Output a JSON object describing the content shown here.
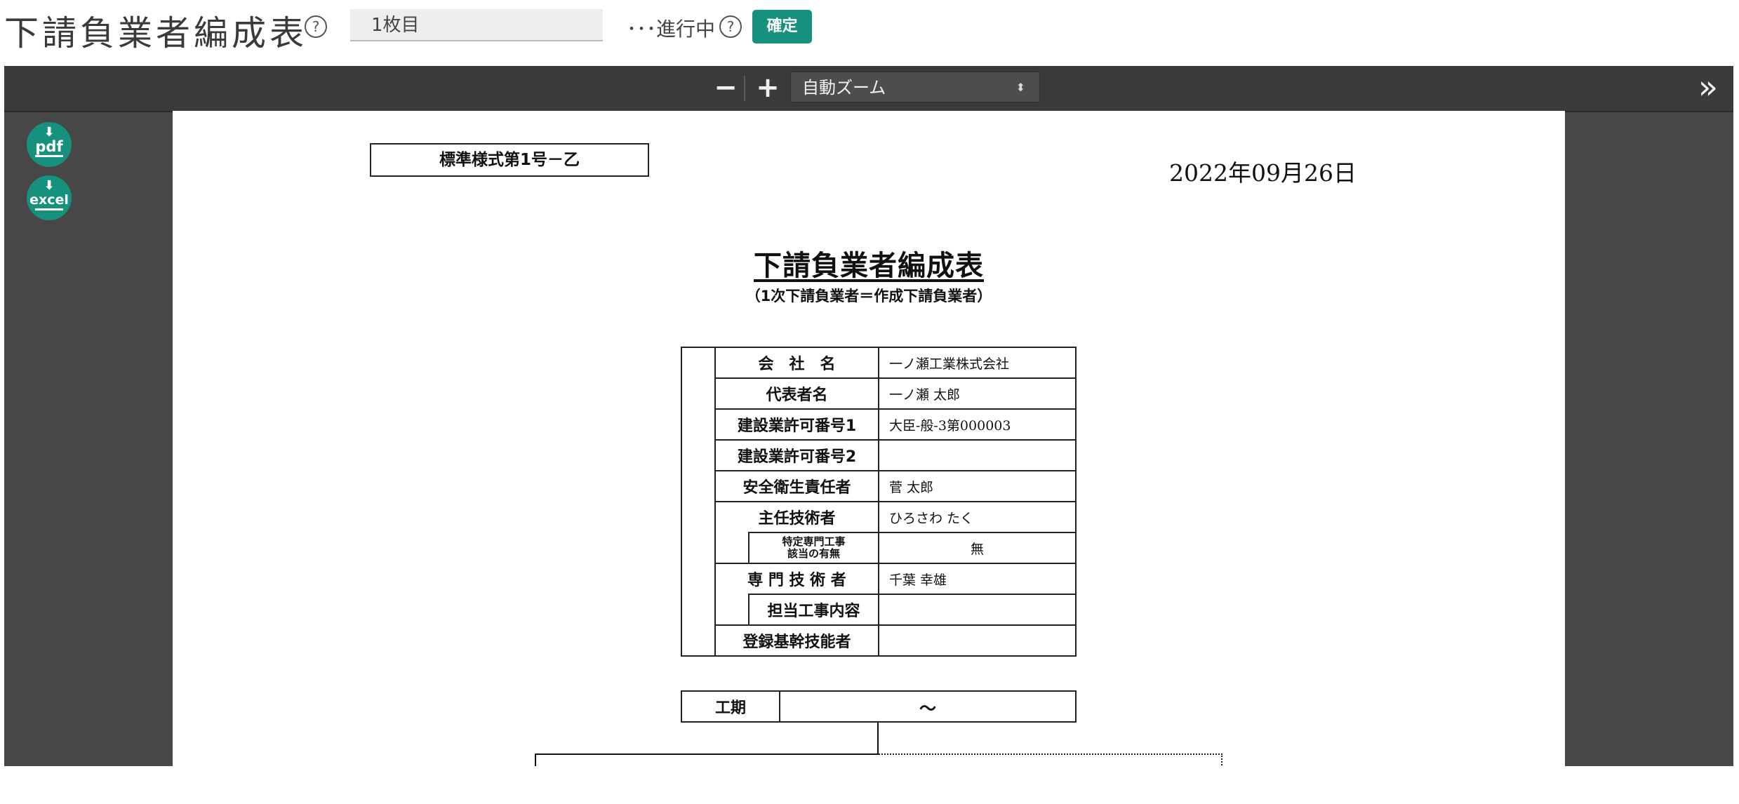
{
  "header": {
    "title": "下請負業者編成表",
    "sheet_value": "1枚目",
    "status": "･･･進行中",
    "confirm_label": "確定"
  },
  "icons": {
    "help": "?",
    "minus": "−",
    "plus": "+",
    "sidebar": "»",
    "select_caret": "⬍",
    "download_arrow": "⬇"
  },
  "viewer": {
    "zoom_option": "自動ズーム",
    "download_pdf_label": "pdf",
    "download_excel_label": "excel"
  },
  "document": {
    "form_code": "標準様式第1号－乙",
    "date": "2022年09月26日",
    "title": "下請負業者編成表",
    "subtitle": "（1次下請負業者＝作成下請負業者）",
    "rows": {
      "company": {
        "label": "会　社　名",
        "value": "一ノ瀬工業株式会社"
      },
      "representative": {
        "label": "代表者名",
        "value": "一ノ瀬 太郎"
      },
      "permit1": {
        "label": "建設業許可番号1",
        "value": "大臣-般-3第000003"
      },
      "permit2": {
        "label": "建設業許可番号2",
        "value": ""
      },
      "safety_manager": {
        "label": "安全衛生責任者",
        "value": "菅 太郎"
      },
      "chief_engineer": {
        "label": "主任技術者",
        "value": "ひろさわ たく"
      },
      "specialty_flag": {
        "label_line1": "特定専門工事",
        "label_line2": "該当の有無",
        "value": "無"
      },
      "specialist_engineer": {
        "label": "専 門 技 術 者",
        "value": "千葉 幸雄"
      },
      "assigned_work": {
        "label": "担当工事内容",
        "value": ""
      },
      "registered_skill": {
        "label": "登録基幹技能者",
        "value": ""
      },
      "period": {
        "label": "工期",
        "value": "～"
      }
    }
  },
  "colors": {
    "accent": "#16917e",
    "viewer_bg": "#474747",
    "toolbar_bg": "#3b3b3b"
  }
}
